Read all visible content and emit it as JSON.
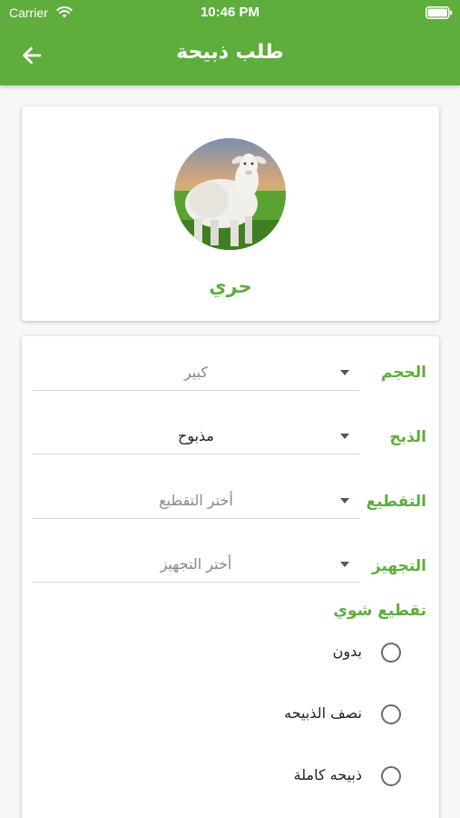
{
  "status_bar": {
    "carrier": "Carrier",
    "time": "10:46 PM"
  },
  "app_bar": {
    "title": "طلب ذبيحة",
    "back_icon": "arrow-left-icon",
    "color": "#5fad3d"
  },
  "product": {
    "name": "حري",
    "image": "sheep-photo"
  },
  "form": {
    "fields": [
      {
        "label": "الحجم",
        "value": "كبير",
        "state": "placeholder"
      },
      {
        "label": "الذبح",
        "value": "مذبوح",
        "state": "selected"
      },
      {
        "label": "التقطيع",
        "value": "أختر التقطيع",
        "state": "placeholder"
      },
      {
        "label": "التجهيز",
        "value": "أختر التجهيز",
        "state": "placeholder"
      }
    ],
    "grill_cut": {
      "title": "تقطيع شوي",
      "options": [
        {
          "label": "بدون",
          "checked": false
        },
        {
          "label": "نصف الذبيحه",
          "checked": false
        },
        {
          "label": "ذبيحه كاملة",
          "checked": false
        }
      ]
    }
  },
  "colors": {
    "accent": "#5fad3d",
    "text": "#222222",
    "placeholder": "#8a8a8a"
  }
}
